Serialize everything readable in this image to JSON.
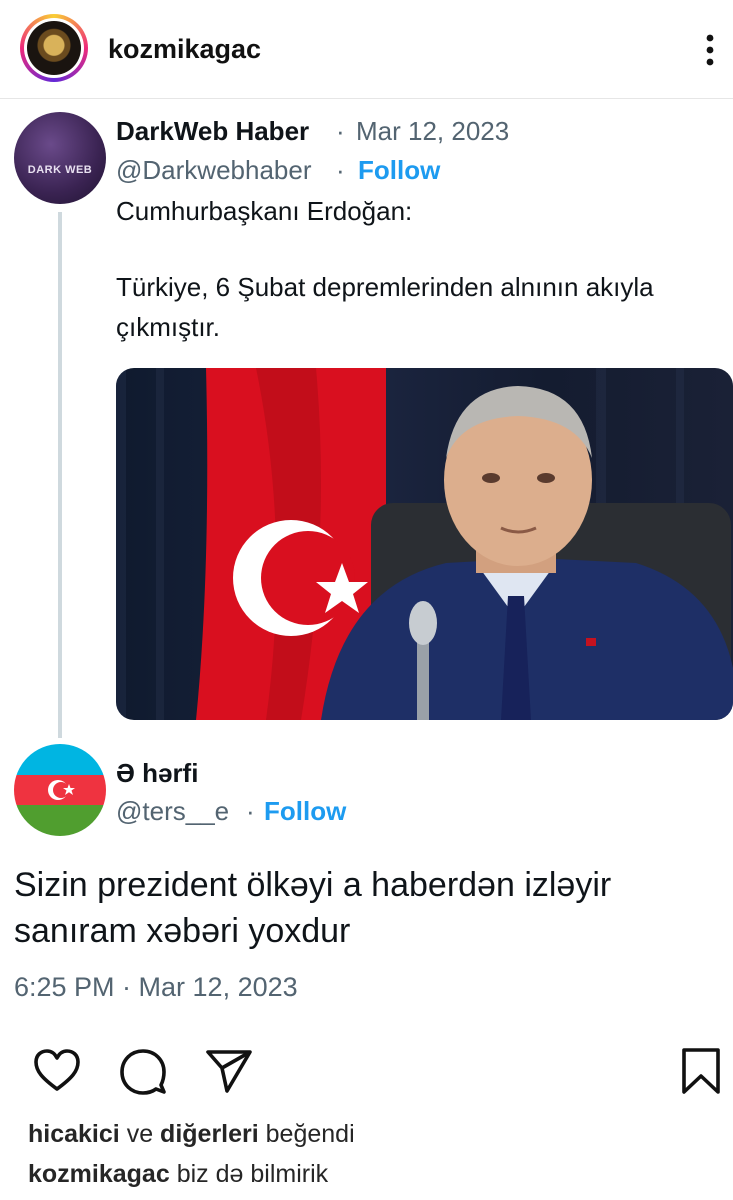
{
  "instagram": {
    "username": "kozmikagac",
    "likes": {
      "user": "hicakici",
      "connector": "ve",
      "others": "diğerleri",
      "suffix": "beğendi"
    },
    "caption": {
      "user": "kozmikagac",
      "text": "biz də bilmirik"
    }
  },
  "tweet1": {
    "name": "DarkWeb Haber",
    "separator": "·",
    "date": "Mar 12, 2023",
    "handle": "@Darkwebhaber",
    "follow_label": "Follow",
    "line1": "Cumhurbaşkanı Erdoğan:",
    "line2": "Türkiye, 6 Şubat depremlerinden alnının akıyla",
    "line3": "çıkmıştır.",
    "avatar_text": "DARK WEB"
  },
  "tweet2": {
    "name": "Ə hərfi",
    "handle": "@ters__e",
    "separator": "·",
    "follow_label": "Follow",
    "text_line1": "Sizin prezident ölkəyi a haberdən izləyir",
    "text_line2": "sanıram xəbəri yoxdur",
    "timestamp": "6:25 PM · Mar 12, 2023"
  },
  "icons": {
    "more": "more-vertical-icon",
    "like": "heart-icon",
    "comment": "comment-icon",
    "share": "send-icon",
    "save": "bookmark-icon"
  },
  "colors": {
    "follow": "#1d9bf0",
    "secondary_text": "#536471",
    "flag_red": "#e30a17",
    "az_blue": "#00b5e2",
    "az_red": "#ef3340",
    "az_green": "#509e2f"
  }
}
